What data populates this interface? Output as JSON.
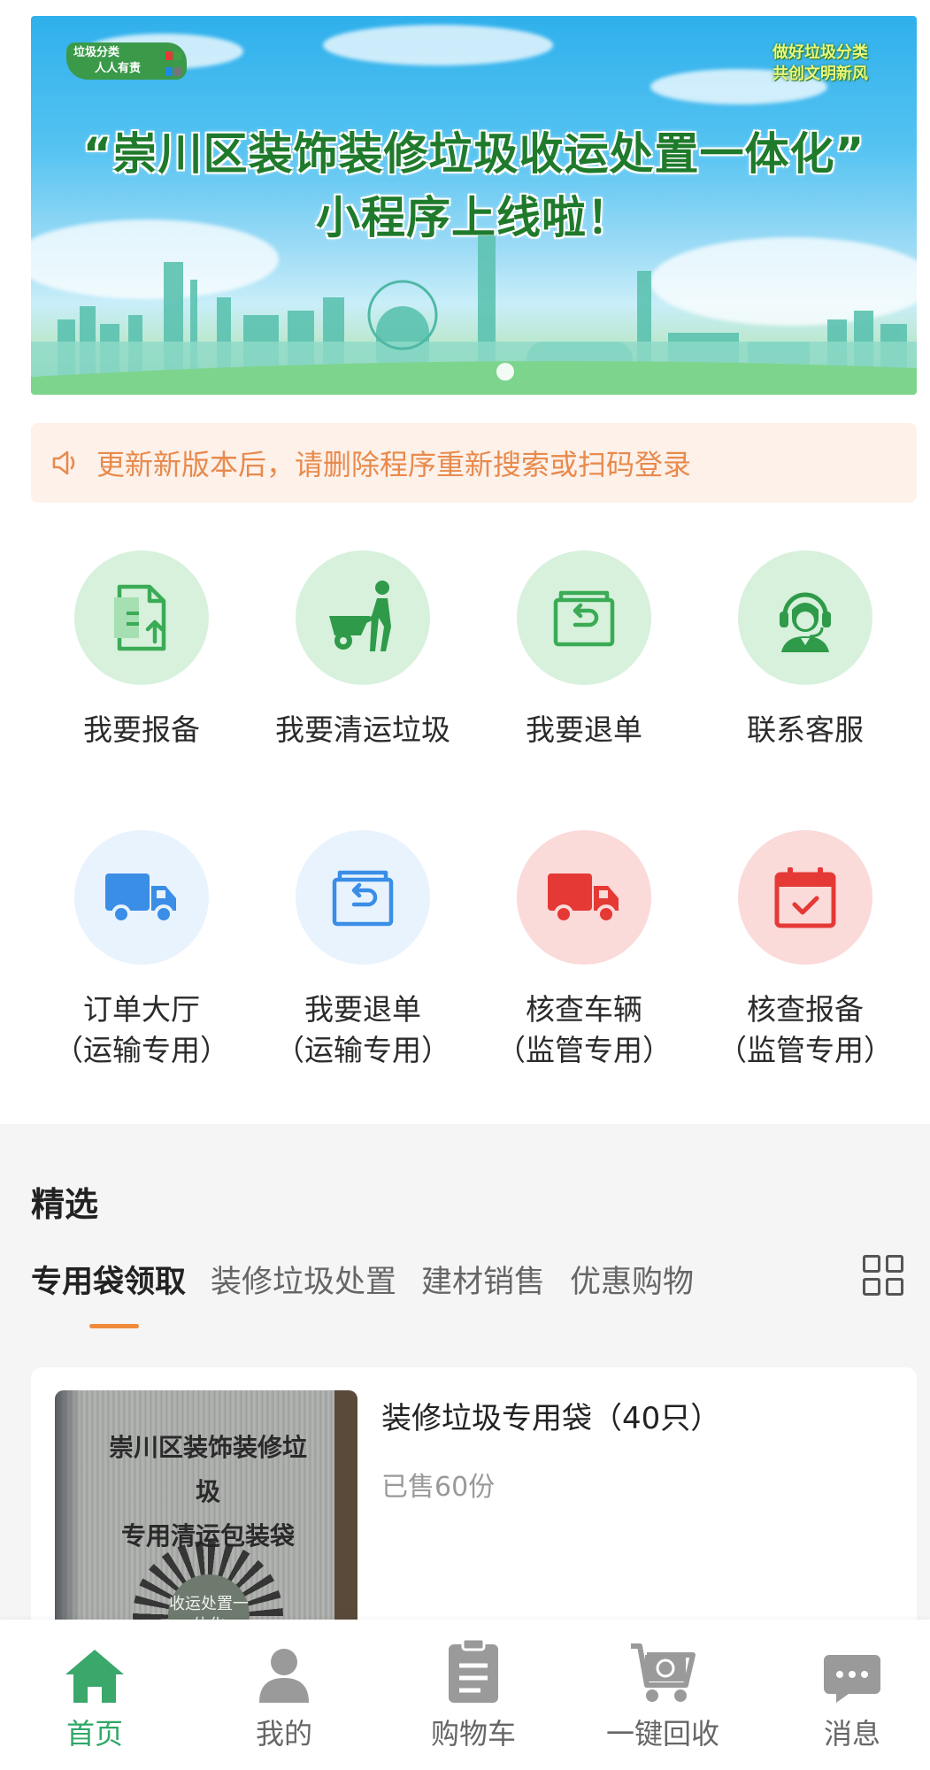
{
  "banner": {
    "logo_left_line1": "垃圾分类",
    "logo_left_line2": "人人有责",
    "logo_right_line1": "做好垃圾分类",
    "logo_right_line2": "共创文明新风",
    "title_line1": "“崇川区装饰装修垃圾收运处置一体化”",
    "title_line2": "小程序上线啦！"
  },
  "notice": {
    "icon": "speaker-icon",
    "text": "更新新版本后，请删除程序重新搜索或扫码登录"
  },
  "functions": [
    {
      "label": "我要报备",
      "icon": "document-upload-icon",
      "color": "#3bab56"
    },
    {
      "label": "我要清运垃圾",
      "icon": "wheelbarrow-worker-icon",
      "color": "#3bab56"
    },
    {
      "label": "我要退单",
      "icon": "box-return-icon",
      "color": "#3bab56"
    },
    {
      "label": "联系客服",
      "icon": "customer-service-icon",
      "color": "#3bab56"
    },
    {
      "label": "订单大厅",
      "sub": "（运输专用）",
      "icon": "truck-icon",
      "color": "#3a8ee6"
    },
    {
      "label": "我要退单",
      "sub": "（运输专用）",
      "icon": "box-return-icon",
      "color": "#3a8ee6"
    },
    {
      "label": "核查车辆",
      "sub": "（监管专用）",
      "icon": "truck-icon",
      "color": "#e53935"
    },
    {
      "label": "核查报备",
      "sub": "（监管专用）",
      "icon": "calendar-check-icon",
      "color": "#e53935"
    }
  ],
  "featured": {
    "title": "精选",
    "tabs": [
      "专用袋领取",
      "装修垃圾处置",
      "建材销售",
      "优惠购物"
    ],
    "active_tab": 0,
    "product": {
      "name": "装修垃圾专用袋（40只）",
      "sold": "已售60份",
      "image_text_line1": "崇川区装饰装修垃圾",
      "image_text_line2": "专用清运包装袋",
      "image_badge": "收运处置一体化"
    }
  },
  "bottom_nav": [
    {
      "label": "首页",
      "icon": "home-icon",
      "active": true
    },
    {
      "label": "我的",
      "icon": "person-icon",
      "active": false
    },
    {
      "label": "购物车",
      "icon": "clipboard-icon",
      "active": false
    },
    {
      "label": "一键回收",
      "icon": "recycle-cart-icon",
      "active": false
    },
    {
      "label": "消息",
      "icon": "message-icon",
      "active": false
    }
  ],
  "colors": {
    "primary_green": "#2fa866",
    "notice_orange": "#e88a4c",
    "tab_underline": "#f08a3c"
  }
}
